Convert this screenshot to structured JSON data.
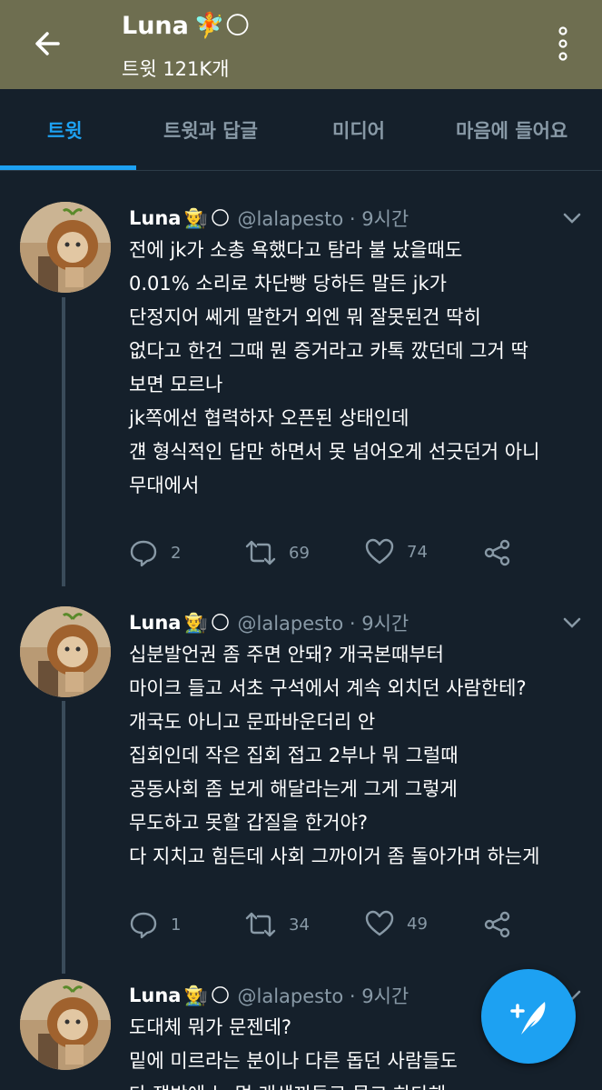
{
  "header": {
    "title": "Luna",
    "title_emoji_1": "🧚",
    "title_emoji_2": "🌕",
    "subtitle": "트윗 121K개"
  },
  "tabs": [
    {
      "label": "트윗",
      "active": true
    },
    {
      "label": "트윗과 답글",
      "active": false
    },
    {
      "label": "미디어",
      "active": false
    },
    {
      "label": "마음에 들어요",
      "active": false
    }
  ],
  "tweets": [
    {
      "name": "Luna",
      "emoji_1": "👨‍🌾",
      "emoji_2": "🌕",
      "meta": "@lalapesto · 9시간",
      "lines": [
        "전에 jk가 소총 욕했다고 탐라 불 났을때도",
        "0.01% 소리로 차단빵 당하든 말든 jk가",
        "단정지어 쎄게 말한거 외엔 뭐 잘못된건 딱히",
        "없다고 한건 그때 뭔 증거라고 카톡 깠던데 그거 딱",
        "보면 모르나",
        "jk쪽에선 협력하자 오픈된 상태인데",
        "걘 형식적인 답만 하면서 못 넘어오게 선긋던거 아니",
        "무대에서"
      ],
      "replies": "2",
      "retweets": "69",
      "likes": "74"
    },
    {
      "name": "Luna",
      "emoji_1": "👨‍🌾",
      "emoji_2": "🌕",
      "meta": "@lalapesto · 9시간",
      "lines": [
        "십분발언권 좀 주면 안돼? 개국본때부터",
        "마이크 들고 서초 구석에서 계속 외치던 사람한테?",
        "개국도 아니고 문파바운더리 안",
        "집회인데 작은 집회 접고 2부나 뭐 그럴때",
        "공동사회 좀 보게 해달라는게 그게 그렇게",
        "무도하고 못할 갑질을 한거야?",
        "다 지치고 힘든데 사회 그까이거 좀 돌아가며 하는게"
      ],
      "replies": "1",
      "retweets": "34",
      "likes": "49"
    },
    {
      "name": "Luna",
      "emoji_1": "👨‍🌾",
      "emoji_2": "🌕",
      "meta": "@lalapesto · 9시간",
      "lines": [
        "도대체 뭐가 문젠데?",
        "밑에 미르라는 분이나 다른 돕던 사람들도",
        "다 잼방에 눈 멀 래색끼들로 몰고 하다해"
      ]
    }
  ]
}
